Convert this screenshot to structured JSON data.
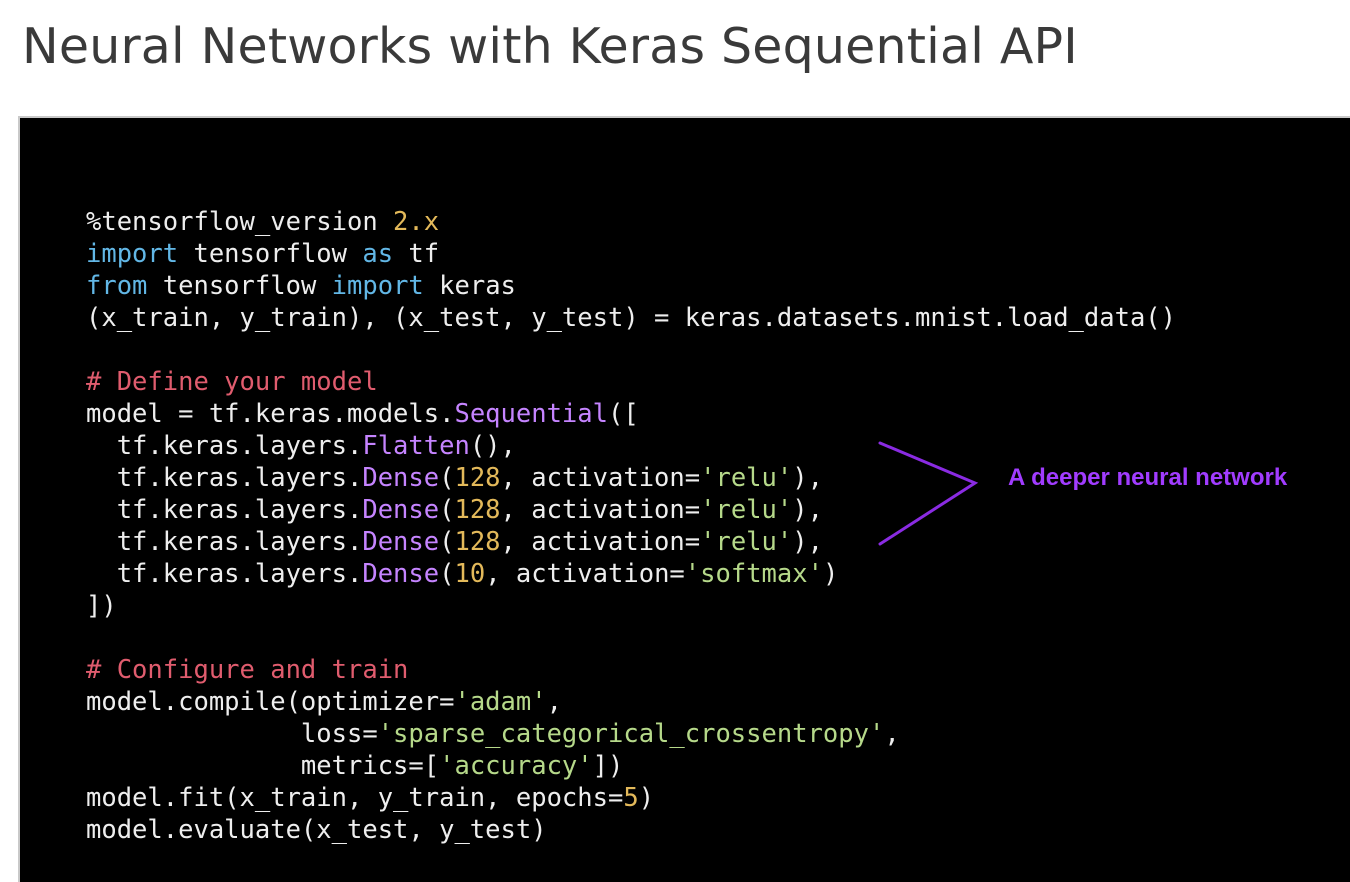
{
  "page": {
    "title": "Neural Networks with Keras Sequential API"
  },
  "code": {
    "lines": [
      [
        {
          "t": "%tensorflow_version ",
          "c": "plain"
        },
        {
          "t": "2.x",
          "c": "orange"
        }
      ],
      [
        {
          "t": "import",
          "c": "blue"
        },
        {
          "t": " tensorflow ",
          "c": "plain"
        },
        {
          "t": "as",
          "c": "blue"
        },
        {
          "t": " tf",
          "c": "plain"
        }
      ],
      [
        {
          "t": "from",
          "c": "blue"
        },
        {
          "t": " tensorflow ",
          "c": "plain"
        },
        {
          "t": "import",
          "c": "blue"
        },
        {
          "t": " keras",
          "c": "plain"
        }
      ],
      [
        {
          "t": "(x_train, y_train), (x_test, y_test) = keras.datasets.mnist.load_data()",
          "c": "plain"
        }
      ],
      [],
      [
        {
          "t": "# Define your model",
          "c": "red"
        }
      ],
      [
        {
          "t": "model = tf.keras.models.",
          "c": "plain"
        },
        {
          "t": "Sequential",
          "c": "purple"
        },
        {
          "t": "([",
          "c": "plain"
        }
      ],
      [
        {
          "t": "  tf.keras.layers.",
          "c": "plain"
        },
        {
          "t": "Flatten",
          "c": "purple"
        },
        {
          "t": "(),",
          "c": "plain"
        }
      ],
      [
        {
          "t": "  tf.keras.layers.",
          "c": "plain"
        },
        {
          "t": "Dense",
          "c": "purple"
        },
        {
          "t": "(",
          "c": "plain"
        },
        {
          "t": "128",
          "c": "orange"
        },
        {
          "t": ", activation=",
          "c": "plain"
        },
        {
          "t": "'relu'",
          "c": "green"
        },
        {
          "t": "),",
          "c": "plain"
        }
      ],
      [
        {
          "t": "  tf.keras.layers.",
          "c": "plain"
        },
        {
          "t": "Dense",
          "c": "purple"
        },
        {
          "t": "(",
          "c": "plain"
        },
        {
          "t": "128",
          "c": "orange"
        },
        {
          "t": ", activation=",
          "c": "plain"
        },
        {
          "t": "'relu'",
          "c": "green"
        },
        {
          "t": "),",
          "c": "plain"
        }
      ],
      [
        {
          "t": "  tf.keras.layers.",
          "c": "plain"
        },
        {
          "t": "Dense",
          "c": "purple"
        },
        {
          "t": "(",
          "c": "plain"
        },
        {
          "t": "128",
          "c": "orange"
        },
        {
          "t": ", activation=",
          "c": "plain"
        },
        {
          "t": "'relu'",
          "c": "green"
        },
        {
          "t": "),",
          "c": "plain"
        }
      ],
      [
        {
          "t": "  tf.keras.layers.",
          "c": "plain"
        },
        {
          "t": "Dense",
          "c": "purple"
        },
        {
          "t": "(",
          "c": "plain"
        },
        {
          "t": "10",
          "c": "orange"
        },
        {
          "t": ", activation=",
          "c": "plain"
        },
        {
          "t": "'softmax'",
          "c": "green"
        },
        {
          "t": ")",
          "c": "plain"
        }
      ],
      [
        {
          "t": "])",
          "c": "plain"
        }
      ],
      [],
      [
        {
          "t": "# Configure and train",
          "c": "red"
        }
      ],
      [
        {
          "t": "model.compile(optimizer=",
          "c": "plain"
        },
        {
          "t": "'adam'",
          "c": "green"
        },
        {
          "t": ",",
          "c": "plain"
        }
      ],
      [
        {
          "t": "              loss=",
          "c": "plain"
        },
        {
          "t": "'sparse_categorical_crossentropy'",
          "c": "green"
        },
        {
          "t": ",",
          "c": "plain"
        }
      ],
      [
        {
          "t": "              metrics=[",
          "c": "plain"
        },
        {
          "t": "'accuracy'",
          "c": "green"
        },
        {
          "t": "])",
          "c": "plain"
        }
      ],
      [
        {
          "t": "model.fit(x_train, y_train, epochs=",
          "c": "plain"
        },
        {
          "t": "5",
          "c": "orange"
        },
        {
          "t": ")",
          "c": "plain"
        }
      ],
      [
        {
          "t": "model.evaluate(x_test, y_test)",
          "c": "plain"
        }
      ]
    ]
  },
  "annotation": {
    "label": "A deeper neural network"
  },
  "colors": {
    "background": "#000000",
    "code_text": "#eeeeee",
    "string": "#b6d98a",
    "keyword": "#62b7e6",
    "class_name": "#c584ff",
    "number": "#e3b95a",
    "comment": "#e05c6e",
    "annotation": "#a13cff",
    "title": "#3a3a3a"
  }
}
